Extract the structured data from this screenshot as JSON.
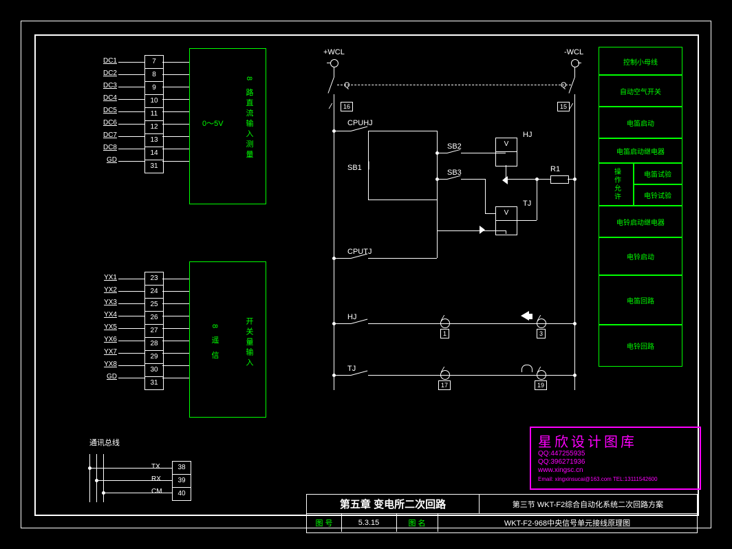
{
  "terminals_dc": {
    "labels": [
      "DC1",
      "DC2",
      "DC3",
      "DC4",
      "DC5",
      "DC6",
      "DC7",
      "DC8",
      "GD"
    ],
    "pins": [
      "7",
      "8",
      "9",
      "10",
      "11",
      "12",
      "13",
      "14",
      "31"
    ]
  },
  "terminals_yx": {
    "labels": [
      "YX1",
      "YX2",
      "YX3",
      "YX4",
      "YX5",
      "YX6",
      "YX7",
      "YX8",
      "GD"
    ],
    "pins": [
      "23",
      "24",
      "25",
      "26",
      "27",
      "28",
      "29",
      "30",
      "31"
    ]
  },
  "terminals_comm": {
    "title": "通讯总线",
    "labels": [
      "TX",
      "RX",
      "CM"
    ],
    "pins": [
      "38",
      "39",
      "40"
    ]
  },
  "block1": {
    "left_label": "0～5V",
    "right_label": "8 路直流输入测量"
  },
  "block2": {
    "left_label": "8 遥 信",
    "right_label": "开关量输入"
  },
  "schematic": {
    "pos_bus": "+WCL",
    "neg_bus": "-WCL",
    "q": "Q",
    "cpuhj": "CPUHJ",
    "cputj": "CPUTJ",
    "sb1": "SB1",
    "sb2": "SB2",
    "sb3": "SB3",
    "hj": "HJ",
    "tj": "TJ",
    "r1": "R1",
    "v": "V",
    "box16": "16",
    "box15": "15",
    "box1": "1",
    "box3": "3",
    "box17": "17",
    "box19": "19"
  },
  "legend": [
    "控制小母线",
    "自动空气开关",
    "电笛启动",
    "电笛启动继电器",
    "操作允许",
    "电笛试验",
    "电铃试验",
    "电铃启动继电器",
    "电铃启动",
    "电笛回路",
    "电铃回路"
  ],
  "titleblock": {
    "chapter": "第五章 变电所二次回路",
    "section": "第三节 WKT-F2综合自动化系统二次回路方案",
    "fig_no_label": "图 号",
    "fig_no": "5.3.15",
    "fig_name_label": "图 名",
    "fig_name": "WKT-F2-968中央信号单元接线原理图"
  },
  "watermark": {
    "title": "星欣设计图库",
    "qq1": "QQ:447255935",
    "qq2": "QQ:396271936",
    "url": "www.xingsc.cn",
    "email": "Email: xingxinsucai@163.com  TEL:13111542600"
  }
}
